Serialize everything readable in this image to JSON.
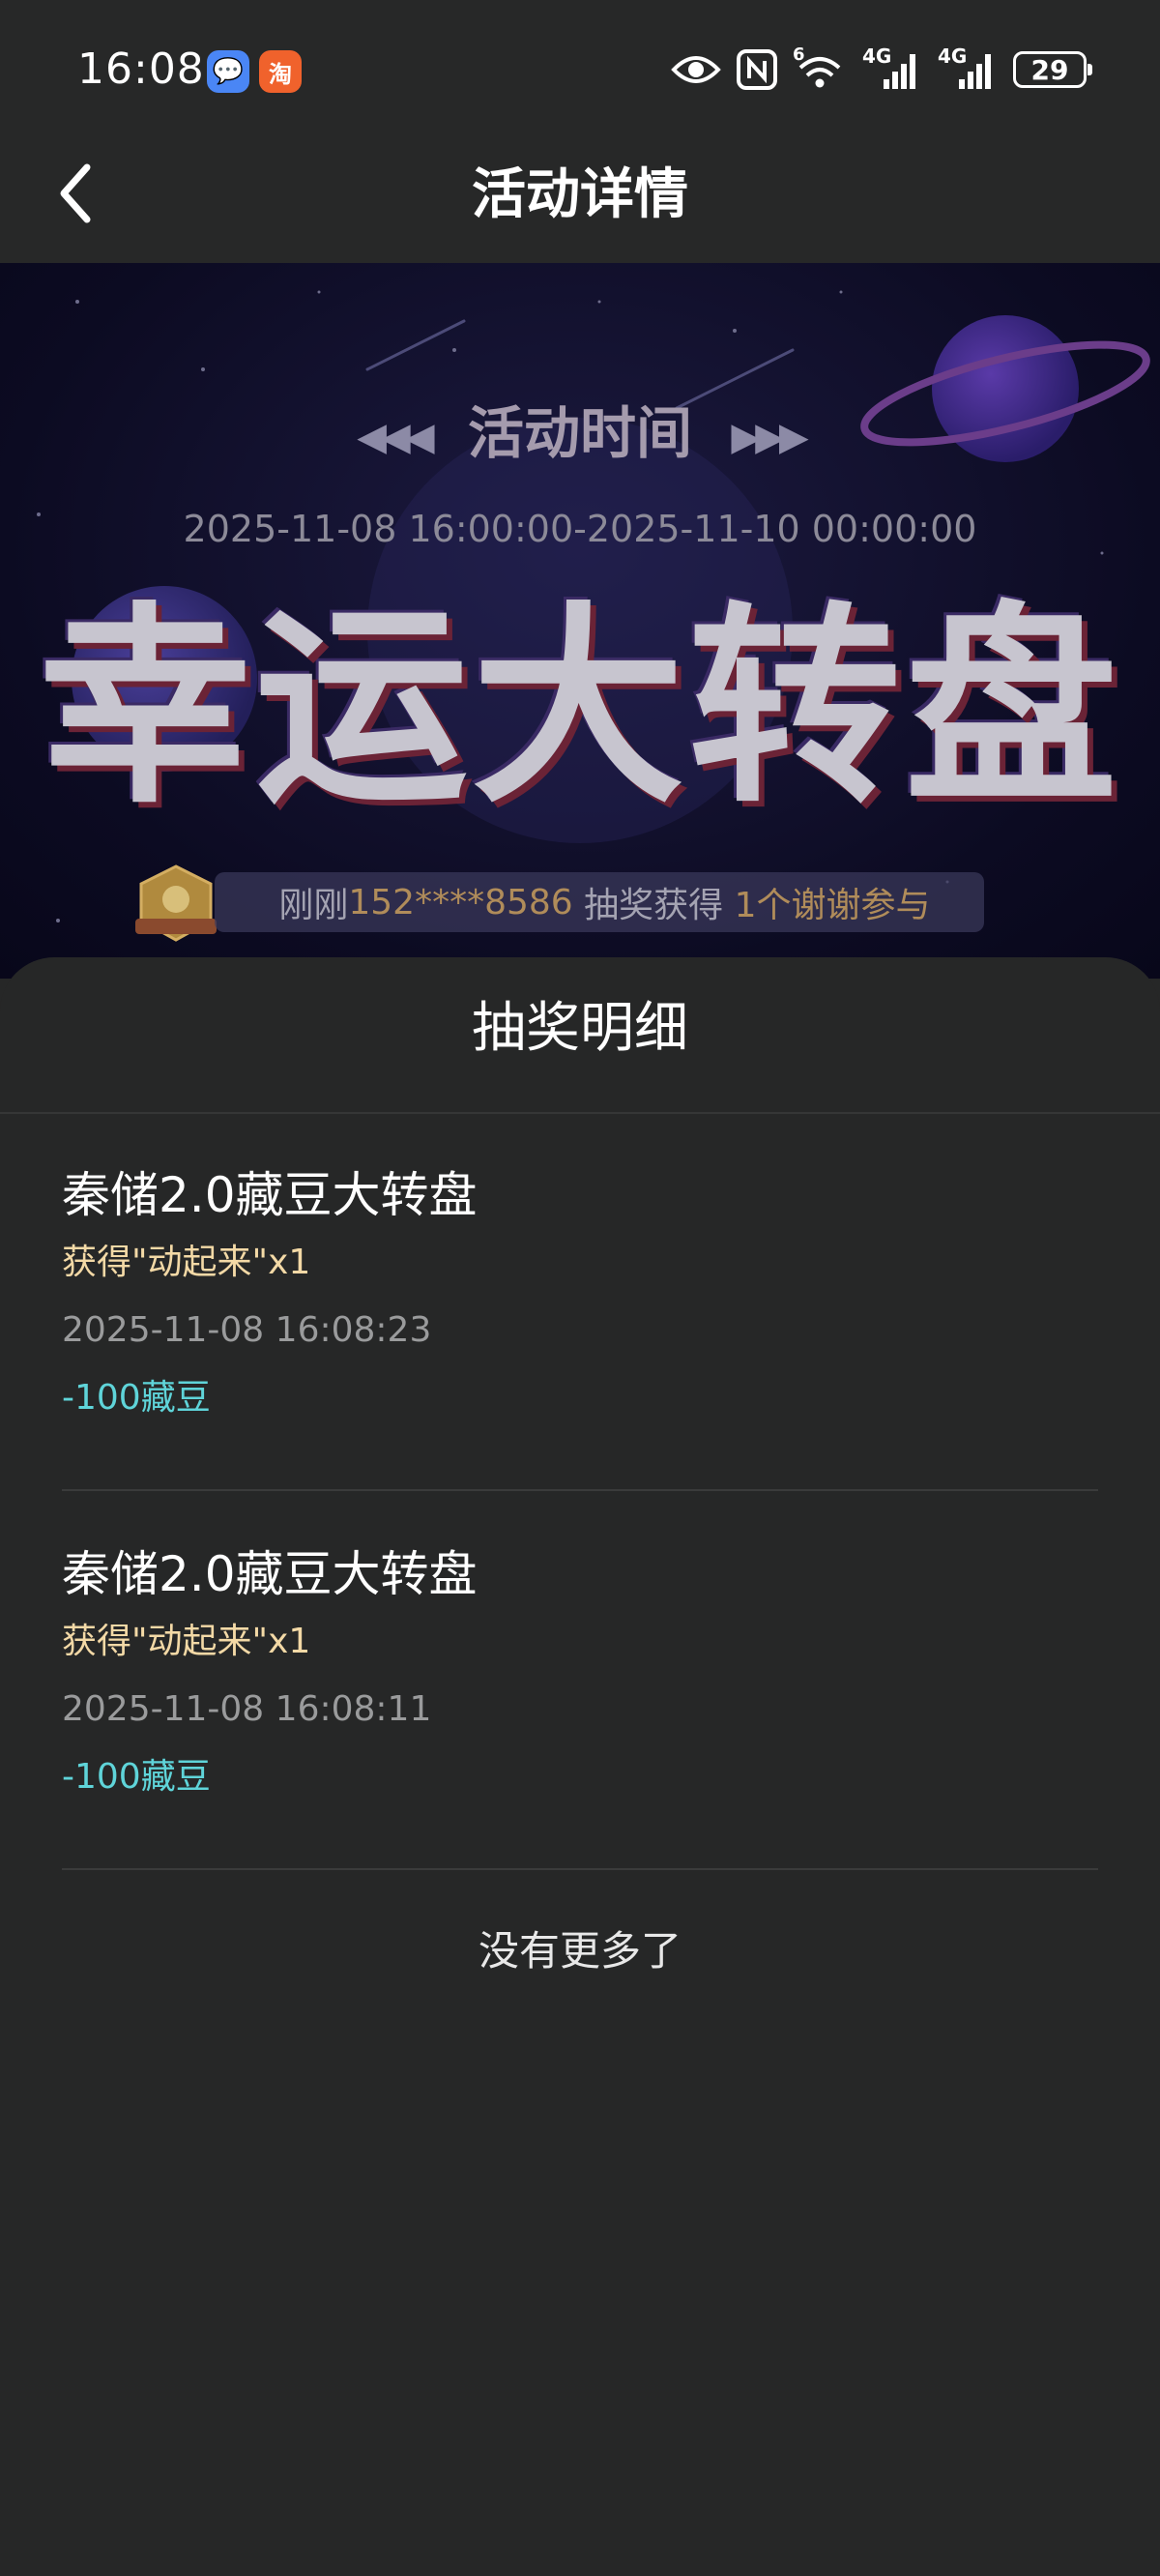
{
  "status_bar": {
    "time": "16:08",
    "app_icons": [
      {
        "name": "message-app-icon",
        "glyph": "💬"
      },
      {
        "name": "taobao-app-icon",
        "glyph": "淘"
      }
    ],
    "signal_labels": {
      "wifi_generation": "6",
      "sim1": "4G",
      "sim2": "4G"
    },
    "battery": "29"
  },
  "nav": {
    "title": "活动详情"
  },
  "banner": {
    "activity_time_label": "活动时间",
    "activity_time_range": "2025-11-08 16:00:00-2025-11-10 00:00:00",
    "title": "幸运大转盘",
    "marquee": {
      "prefix": "刚刚",
      "phone": "152****8586",
      "middle": " 抽奖获得 ",
      "prize": "1个谢谢参与"
    }
  },
  "sheet": {
    "title": "抽奖明细",
    "records": [
      {
        "title": "秦储2.0藏豆大转盘",
        "prize": "获得\"动起来\"x1",
        "time": "2025-11-08 16:08:23",
        "cost": "-100藏豆"
      },
      {
        "title": "秦储2.0藏豆大转盘",
        "prize": "获得\"动起来\"x1",
        "time": "2025-11-08 16:08:11",
        "cost": "-100藏豆"
      }
    ],
    "no_more": "没有更多了"
  },
  "colors": {
    "background": "#262727",
    "prize_text": "#f3d9a6",
    "cost_text": "#5fd4d9",
    "time_text": "#9a9b9c"
  }
}
